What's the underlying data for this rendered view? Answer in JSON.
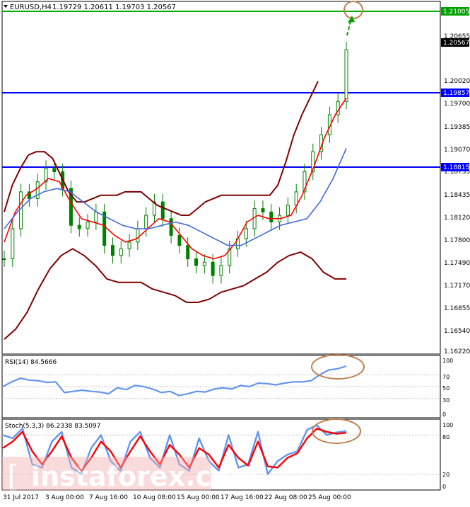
{
  "header": {
    "symbol": "EURUSD,H4",
    "ohlc": "1.19729 1.20611 1.19703 1.20567"
  },
  "price_axis": {
    "ticks": [
      "1.20655",
      "1.20020",
      "1.19700",
      "1.19385",
      "1.19070",
      "1.18755",
      "1.18435",
      "1.18120",
      "1.17800",
      "1.17490",
      "1.17170",
      "1.16855",
      "1.16540",
      "1.16220"
    ],
    "marker_2100": "1.21005",
    "marker_current": "1.20567",
    "marker_1985": "1.19857",
    "marker_1881": "1.18815"
  },
  "rsi": {
    "label": "RSI(14) 84.5666",
    "ticks": [
      "100",
      "70",
      "50",
      "30",
      "0"
    ]
  },
  "stoch": {
    "label": "Stoch(5,3,3) 86.2338 83.5097",
    "ticks": [
      "100",
      "80",
      "20",
      "0"
    ]
  },
  "time_axis": {
    "ticks": [
      "31 Jul 2017",
      "3 Aug 00:00",
      "7 Aug 16:00",
      "10 Aug 08:00",
      "15 Aug 00:00",
      "17 Aug 16:00",
      "22 Aug 08:00",
      "25 Aug 00:00"
    ]
  },
  "watermark": "instaforex.com",
  "colors": {
    "bollinger": "#800000",
    "ma_fast": "#ff0000",
    "ma_slow": "#4169e1",
    "candle": "#008000",
    "level_line": "#0000ff",
    "target_line": "#00b000",
    "annotation": "#c08050",
    "rsi_line": "#6495ed",
    "stoch_main": "#6495ed",
    "stoch_signal": "#ff0000"
  },
  "chart_data": [
    {
      "type": "candlestick",
      "title": "EURUSD,H4",
      "ylim": [
        1.1605,
        1.2125
      ],
      "x_start": "31 Jul 2017",
      "x_end": "25 Aug 2017 (last bar)",
      "horizontal_levels": [
        {
          "value": 1.21005,
          "color": "#00b000",
          "role": "target"
        },
        {
          "value": 1.19857,
          "color": "#0000ff",
          "role": "resistance"
        },
        {
          "value": 1.18815,
          "color": "#0000ff",
          "role": "support"
        }
      ],
      "series": [
        {
          "name": "",
          "indicator": "price",
          "values": [
            1.1745,
            1.179,
            1.1845,
            1.1835,
            1.186,
            1.188,
            1.1875,
            1.185,
            1.1795,
            1.179,
            1.18,
            1.1815,
            1.1765,
            1.175,
            1.176,
            1.177,
            1.179,
            1.181,
            1.183,
            1.1805,
            1.178,
            1.1765,
            1.1745,
            1.1735,
            1.174,
            1.172,
            1.1735,
            1.176,
            1.1775,
            1.179,
            1.182,
            1.1815,
            1.18,
            1.181,
            1.1825,
            1.1845,
            1.1875,
            1.1905,
            1.193,
            1.196,
            1.198,
            1.2057
          ]
        },
        {
          "name": "",
          "indicator": "bollinger_upper",
          "values": [
            1.1815,
            1.1855,
            1.188,
            1.19,
            1.1905,
            1.1905,
            1.1895,
            1.187,
            1.1845,
            1.183,
            1.183,
            1.1835,
            1.184,
            1.184,
            1.184,
            1.1845,
            1.1845,
            1.1845,
            1.1835,
            1.1825,
            1.182,
            1.1815,
            1.181,
            1.181,
            1.182,
            1.183,
            1.1835,
            1.184,
            1.184,
            1.184,
            1.184,
            1.184,
            1.184,
            1.184,
            1.1855,
            1.189,
            1.193,
            1.196,
            1.1985,
            1.201
          ]
        },
        {
          "name": "",
          "indicator": "bollinger_lower",
          "values": [
            1.1625,
            1.164,
            1.1665,
            1.17,
            1.173,
            1.175,
            1.176,
            1.175,
            1.1735,
            1.1715,
            1.171,
            1.171,
            1.171,
            1.17,
            1.1695,
            1.169,
            1.168,
            1.168,
            1.1685,
            1.1695,
            1.17,
            1.1705,
            1.1715,
            1.1725,
            1.174,
            1.175,
            1.1755,
            1.1745,
            1.1725,
            1.1715,
            1.1715
          ]
        },
        {
          "name": "",
          "indicator": "ma_fast",
          "values": [
            1.177,
            1.1815,
            1.184,
            1.185,
            1.1865,
            1.186,
            1.183,
            1.1805,
            1.18,
            1.1795,
            1.178,
            1.177,
            1.1775,
            1.179,
            1.1805,
            1.18,
            1.178,
            1.176,
            1.175,
            1.1745,
            1.175,
            1.177,
            1.18,
            1.181,
            1.1805,
            1.1805,
            1.181,
            1.184,
            1.188,
            1.1925,
            1.196,
            1.1985
          ]
        },
        {
          "name": "",
          "indicator": "ma_slow",
          "values": [
            1.179,
            1.1815,
            1.1835,
            1.1845,
            1.185,
            1.1845,
            1.183,
            1.1815,
            1.1805,
            1.1795,
            1.179,
            1.179,
            1.1795,
            1.18,
            1.1795,
            1.1785,
            1.1775,
            1.1765,
            1.1765,
            1.1775,
            1.1785,
            1.1795,
            1.18,
            1.1805,
            1.183,
            1.1865,
            1.191
          ]
        }
      ]
    },
    {
      "type": "line",
      "title": "RSI(14) 84.5666",
      "ylim": [
        0,
        100
      ],
      "levels": [
        70,
        50,
        30
      ],
      "series": [
        {
          "name": "RSI(14)",
          "values": [
            50,
            58,
            64,
            61,
            60,
            57,
            58,
            40,
            42,
            44,
            42,
            41,
            38,
            48,
            45,
            52,
            50,
            46,
            40,
            42,
            35,
            38,
            42,
            41,
            46,
            48,
            46,
            52,
            50,
            56,
            55,
            53,
            56,
            58,
            58,
            60,
            70,
            78,
            80,
            84.5666
          ]
        }
      ]
    },
    {
      "type": "line",
      "title": "Stoch(5,3,3) 86.2338 83.5097",
      "ylim": [
        0,
        100
      ],
      "levels": [
        80,
        20
      ],
      "series": [
        {
          "name": "Stoch(5,3,3) main",
          "values": [
            80,
            75,
            90,
            35,
            30,
            70,
            85,
            30,
            20,
            60,
            80,
            40,
            25,
            70,
            85,
            45,
            30,
            80,
            35,
            25,
            75,
            40,
            25,
            80,
            30,
            35,
            85,
            20,
            40,
            50,
            55,
            88,
            95,
            80,
            84,
            86.2338
          ]
        },
        {
          "name": "Stoch(5,3,3) signal",
          "values": [
            60,
            70,
            85,
            55,
            35,
            55,
            78,
            45,
            25,
            45,
            70,
            55,
            30,
            55,
            78,
            55,
            35,
            65,
            50,
            30,
            60,
            50,
            30,
            65,
            45,
            33,
            70,
            32,
            30,
            45,
            52,
            75,
            90,
            85,
            82,
            83.5097
          ]
        }
      ]
    }
  ]
}
